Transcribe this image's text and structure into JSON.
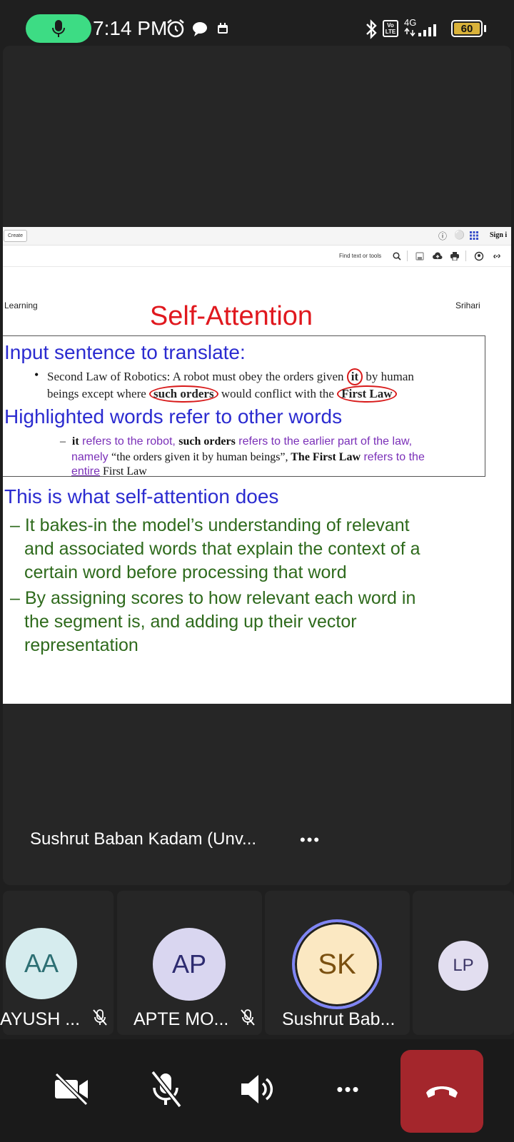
{
  "status_bar": {
    "time": "7:14 PM",
    "battery": "60",
    "network": "4G",
    "volte": "Vo LTE",
    "call_pill_color": "#3ddc84",
    "icons": [
      "mic-icon",
      "alarm-icon",
      "chat-bubble-icon",
      "calendar-icon",
      "bluetooth-icon",
      "signal-icon",
      "battery-icon"
    ]
  },
  "pdf_toolbar": {
    "create_label": "Create",
    "sign_in_label": "Sign i",
    "find_label": "Find text or tools"
  },
  "slide": {
    "header_left": "Learning",
    "header_right": "Srihari",
    "title": "Self-Attention",
    "box_heading1": "Input sentence to translate:",
    "bullet_line1_a": "Second Law of Robotics: A robot must obey the orders given ",
    "bullet_line1_circled": "it",
    "bullet_line1_b": " by human",
    "bullet_line2_a": "beings except where ",
    "bullet_line2_circled": "such orders",
    "bullet_line2_b": " would conflict with the ",
    "bullet_line2_circled2": "First Law",
    "box_heading2": "Highlighted words refer to other words",
    "sub_line1_dash": "–",
    "sub_line1_b1": "it",
    "sub_line1_t1": " refers to the robot, ",
    "sub_line1_b2": "such orders",
    "sub_line1_t2": " refers to the earlier part of the law,",
    "sub_line2_t1": "namely ",
    "sub_line2_q": "“the orders given it by human beings”,",
    "sub_line2_b": " The First Law",
    "sub_line2_t2": " refers to the",
    "sub_line3_t1": "entire",
    "sub_line3_s": " First Law",
    "heading3": "This is what self-attention does",
    "green_lines": [
      "– It bakes-in the model’s understanding of relevant",
      "and associated words that explain the context of a",
      "certain word before processing that word",
      "– By assigning scores to how relevant each word in",
      "the segment is, and adding up their vector",
      "representation"
    ]
  },
  "speaker": {
    "name": "Sushrut Baban Kadam (Unv...",
    "more": "•••"
  },
  "participants": [
    {
      "initials": "AA",
      "name": "AYUSH ...",
      "avatar_bg": "#d6ecee",
      "avatar_fg": "#2d6f73",
      "muted": true
    },
    {
      "initials": "AP",
      "name": "APTE MO...",
      "avatar_bg": "#d9d6f0",
      "avatar_fg": "#2d2b70",
      "muted": true
    },
    {
      "initials": "SK",
      "name": "Sushrut Bab...",
      "avatar_bg": "#fbe8c2",
      "avatar_fg": "#7a5010",
      "speaking": true
    },
    {
      "initials": "LP",
      "avatar_bg": "#e2def0",
      "avatar_fg": "#3b3566"
    }
  ],
  "controls": {
    "camera": "camera-off-icon",
    "mic": "mic-off-icon",
    "speaker": "speaker-icon",
    "more": "•••",
    "end_call_color": "#a4262c"
  }
}
